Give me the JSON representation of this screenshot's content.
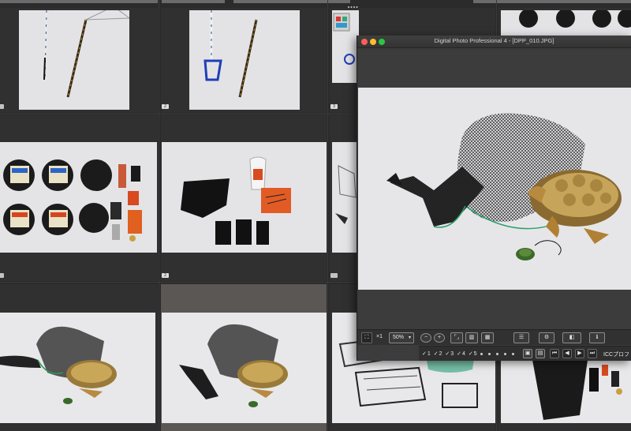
{
  "window": {
    "title": "Digital Photo Professional 4 - [DPP_010.JPG]",
    "controls": {
      "close_color": "#ff5f57",
      "minimize_color": "#febc2e",
      "zoom_color": "#28c840"
    }
  },
  "toolbar": {
    "fit_icon": "fit-screen-icon",
    "zoom_1x_label": "×1",
    "zoom_value": "50%",
    "zoom_out_icon": "minus-circle-icon",
    "zoom_in_icon": "plus-circle-icon",
    "icc_label": "ICCプロフ"
  },
  "thumbnails": {
    "badges": [
      "",
      "2",
      "3",
      "",
      "2",
      "",
      "",
      "",
      ""
    ]
  },
  "colors": {
    "background": "#2b2b2b",
    "cell": "#303030",
    "selected_cell": "#5a5754",
    "window": "#3b3b3b"
  }
}
